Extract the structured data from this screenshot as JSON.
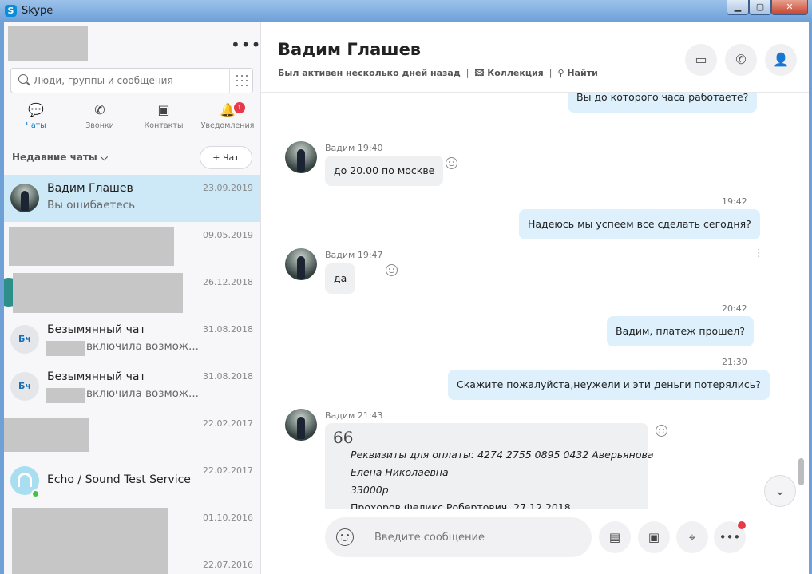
{
  "window": {
    "title": "Skype",
    "min_glyph": "▁",
    "max_glyph": "▢",
    "close_glyph": "✕"
  },
  "sidebar": {
    "more_glyph": "•••",
    "search_placeholder": "Люди, группы и сообщения",
    "tabs": [
      {
        "label": "Чаты",
        "icon": "chat-icon",
        "glyph": "💬"
      },
      {
        "label": "Звонки",
        "icon": "phone-icon",
        "glyph": "✆"
      },
      {
        "label": "Контакты",
        "icon": "contacts-icon",
        "glyph": "▣"
      },
      {
        "label": "Уведомления",
        "icon": "bell-icon",
        "glyph": "🔔"
      }
    ],
    "notification_count": "1",
    "recent_label": "Недавние чаты ⌵",
    "new_chat_label": "+ Чат",
    "conversations": [
      {
        "name": "Вадим Глашев",
        "preview": "Вы ошибаетесь",
        "date": "23.09.2019"
      },
      {
        "name": "",
        "preview": "",
        "date": "09.05.2019"
      },
      {
        "name": "",
        "preview": "",
        "date": "26.12.2018"
      },
      {
        "name": "Безымянный чат",
        "preview": "включила возмож...",
        "date": "31.08.2018",
        "initials": "Бч"
      },
      {
        "name": "Безымянный чат",
        "preview": "включила возмож...",
        "date": "31.08.2018",
        "initials": "Бч"
      },
      {
        "name": "",
        "preview": "",
        "date": "22.02.2017"
      },
      {
        "name": "Echo / Sound Test Service",
        "preview": "",
        "date": "22.02.2017"
      },
      {
        "name": "",
        "preview": "",
        "date": "01.10.2016"
      },
      {
        "name": "",
        "preview": "",
        "date": "22.07.2016"
      }
    ]
  },
  "chat": {
    "contact_name": "Вадим Глашев",
    "status": "Был активен несколько дней назад",
    "separator": "|",
    "collection_label": "🖾 Коллекция",
    "find_label": "⚲ Найти",
    "header_buttons": {
      "video": "▭",
      "call": "✆",
      "add": "👤"
    },
    "messages": [
      {
        "dir": "out",
        "time": "",
        "text": "Вы до которого часа работаете?"
      },
      {
        "dir": "in",
        "meta": "Вадим 19:40",
        "text": "до 20.00 по москве"
      },
      {
        "dir": "out",
        "time": "19:42",
        "text": "Надеюсь мы успеем все сделать сегодня?"
      },
      {
        "dir": "in",
        "meta": "Вадим 19:47",
        "text": "да"
      },
      {
        "dir": "out",
        "time": "20:42",
        "text": "Вадим, платеж прошел?"
      },
      {
        "dir": "out",
        "time": "21:30",
        "text": "Скажите пожалуйста,неужели и эти деньги потерялись?"
      },
      {
        "dir": "in",
        "meta": "Вадим 21:43",
        "quote_mark": "66",
        "quote_lines": [
          "Реквизиты для оплаты: 4274 2755 0895 0432 Аверьянова",
          "Елена Николаевна",
          "33000р"
        ],
        "quote_author": "Прохоров Феликс Робертович, 27.12.2018"
      }
    ],
    "row_menu": "⋮",
    "scroll_down": "⌄",
    "composer_placeholder": "Введите сообщение",
    "composer_buttons": {
      "media": "▤",
      "contact": "▣",
      "location": "⌖",
      "more": "•••"
    }
  }
}
